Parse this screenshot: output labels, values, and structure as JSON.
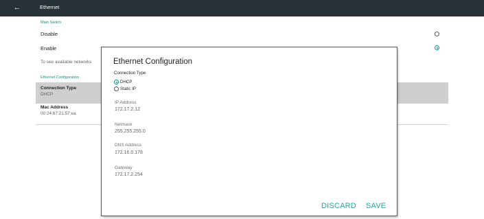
{
  "topbar": {
    "title": "Ethernet",
    "back_icon": "arrow-left-icon"
  },
  "background": {
    "main_switch_header": "Main Switch",
    "disable_label": "Disable",
    "enable_label": "Enable",
    "hint_text": "To see available networks",
    "ethernet_config_header": "Ethernet Configuration",
    "connection_type_title": "Connection Type",
    "connection_type_value": "DHCP",
    "mac_title": "Mac Address",
    "mac_value": "00:24:67:21:57:ea",
    "selected_option": "Enable"
  },
  "dialog": {
    "title": "Ethernet Configuration",
    "connection_type_label": "Connection Type",
    "options": [
      "DHCP",
      "Static IP"
    ],
    "selected_option": "DHCP",
    "fields": [
      {
        "label": "IP Address",
        "value": "172.17.2.12"
      },
      {
        "label": "Netmask",
        "value": "255.255.255.0"
      },
      {
        "label": "DNS Address",
        "value": "172.16.0.178"
      },
      {
        "label": "Gateway",
        "value": "172.17.2.254"
      }
    ],
    "discard_label": "DISCARD",
    "save_label": "SAVE"
  },
  "colors": {
    "accent": "#009688",
    "topbar": "#263238",
    "button_text": "#26a69a"
  }
}
